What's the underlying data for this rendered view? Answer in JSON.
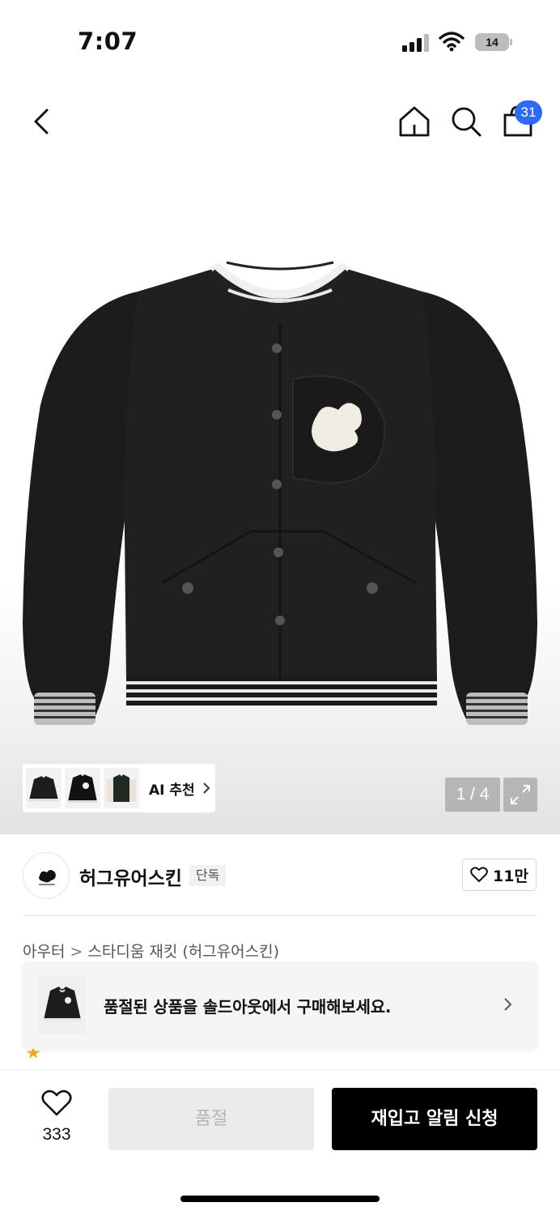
{
  "status_bar": {
    "time": "7:07",
    "battery_level": "14"
  },
  "header": {
    "cart_count": "31"
  },
  "gallery": {
    "ai_label": "AI 추천",
    "page_counter": "1 / 4"
  },
  "brand": {
    "name": "허그유어스킨",
    "badge": "단독",
    "like_count": "11만"
  },
  "breadcrumb": {
    "category": "아우터",
    "separator": ">",
    "product": "스타디움 재킷 (허그유어스킨)"
  },
  "toast": {
    "message": "품절된 상품을 솔드아웃에서 구매해보세요."
  },
  "bottom_bar": {
    "wish_count": "333",
    "soldout_label": "품절",
    "restock_label": "재입고 알림 신청"
  },
  "colors": {
    "badge_blue": "#2f6bf2",
    "primary_black": "#000000",
    "disabled_gray": "#ebebeb"
  }
}
